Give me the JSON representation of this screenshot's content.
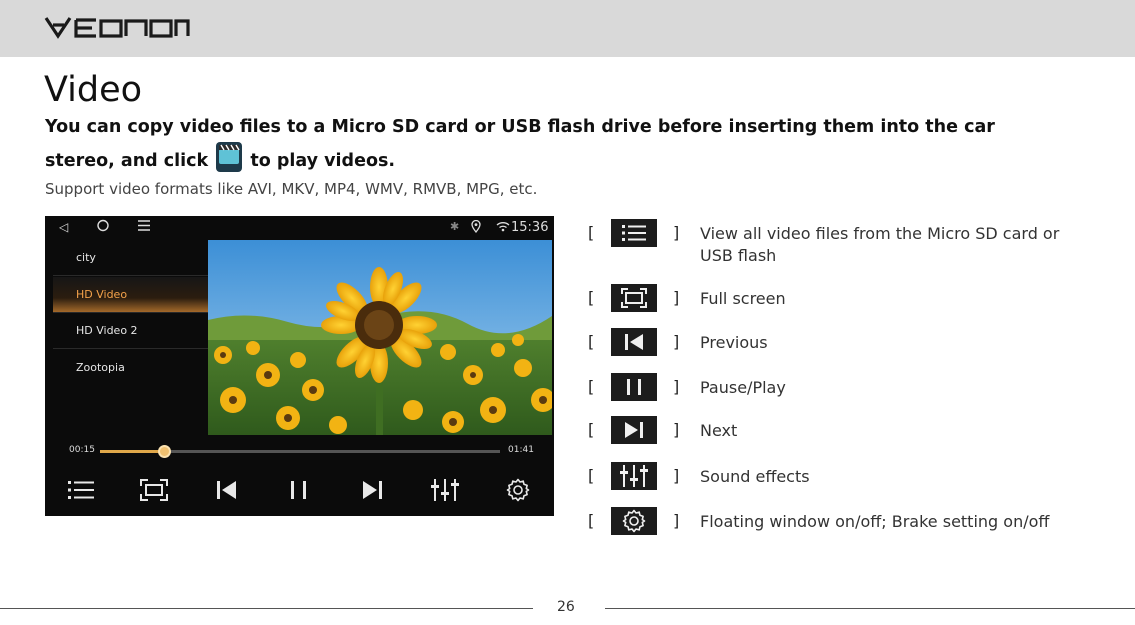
{
  "brand": {
    "name": "Eonon"
  },
  "page": {
    "title": "Video",
    "intro_part1": "You can copy video files to a Micro SD card or USB flash drive before inserting them into the car stereo, and click",
    "intro_part2": "to play videos.",
    "formats": "Support video formats like AVI, MKV, MP4, WMV, RMVB, MPG, etc.",
    "page_number": "26"
  },
  "screen": {
    "status_time": "15:36",
    "playlist": [
      {
        "label": "city",
        "active": false
      },
      {
        "label": "HD Video",
        "active": true
      },
      {
        "label": "HD Video 2",
        "active": false
      },
      {
        "label": "Zootopia",
        "active": false
      }
    ],
    "elapsed": "00:15",
    "duration": "01:41",
    "progress_fraction": 0.16
  },
  "legend": [
    {
      "icon": "list-icon",
      "bracket_open": "[",
      "bracket_close": "]",
      "text": "View all video files from the Micro SD card or USB flash"
    },
    {
      "icon": "fullscreen-icon",
      "bracket_open": "[",
      "bracket_close": "]",
      "text": "Full screen"
    },
    {
      "icon": "previous-icon",
      "bracket_open": "[",
      "bracket_close": "]",
      "text": "Previous"
    },
    {
      "icon": "pause-icon",
      "bracket_open": "[",
      "bracket_close": "]",
      "text": "Pause/Play"
    },
    {
      "icon": "next-icon",
      "bracket_open": "[",
      "bracket_close": "]",
      "text": "Next"
    },
    {
      "icon": "equalizer-icon",
      "bracket_open": "[",
      "bracket_close": "]",
      "text": "Sound effects"
    },
    {
      "icon": "gear-icon",
      "bracket_open": "[",
      "bracket_close": "]",
      "text": "Floating window on/off; Brake setting on/off"
    }
  ],
  "colors": {
    "header_bg": "#d9d9d9",
    "accent_orange": "#f4a24a",
    "icon_bg": "#1c1c1c"
  }
}
